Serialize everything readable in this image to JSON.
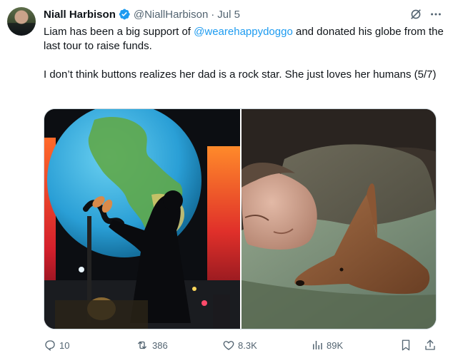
{
  "tweet": {
    "author_name": "Niall Harbison",
    "handle": "@NiallHarbison",
    "separator": "·",
    "date": "Jul 5",
    "text": {
      "line1_before": "Liam has been a big support of ",
      "mention": "@wearehappydoggo",
      "line1_after": " and donated his globe from the last tour to raise funds.",
      "paragraph2": "I don’t think buttons realizes her dad is a rock star. She just loves her humans (5/7)"
    },
    "header_icons": [
      "grok-icon",
      "more-icon"
    ],
    "media": [
      {
        "name": "concert-globe-photo",
        "icon": "photo"
      },
      {
        "name": "sleeping-dog-photo",
        "icon": "photo"
      }
    ],
    "actions": {
      "replies": "10",
      "reposts": "386",
      "likes": "8.3K",
      "views": "89K"
    }
  },
  "colors": {
    "accent": "#1d9bf0",
    "secondary_text": "#536471",
    "border": "#cfd9de"
  }
}
